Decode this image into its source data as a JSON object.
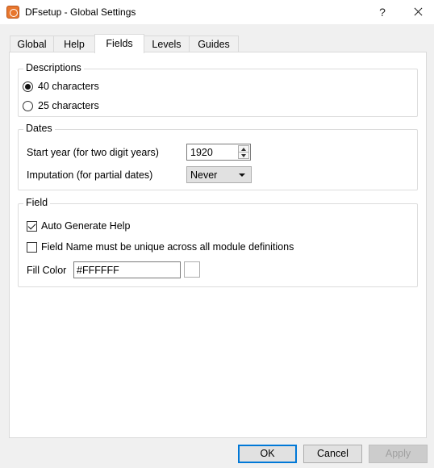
{
  "window": {
    "title": "DFsetup - Global Settings",
    "help_glyph": "?",
    "app_icon": "dfsetup-app-icon",
    "close_icon": "close-icon"
  },
  "tabs": [
    {
      "label": "Global",
      "active": false
    },
    {
      "label": "Help",
      "active": false
    },
    {
      "label": "Fields",
      "active": true
    },
    {
      "label": "Levels",
      "active": false
    },
    {
      "label": "Guides",
      "active": false
    }
  ],
  "descriptions": {
    "title": "Descriptions",
    "options": [
      {
        "label": "40 characters",
        "selected": true
      },
      {
        "label": "25 characters",
        "selected": false
      }
    ]
  },
  "dates": {
    "title": "Dates",
    "start_year_label": "Start year (for two digit years)",
    "start_year_value": "1920",
    "imputation_label": "Imputation (for partial dates)",
    "imputation_value": "Never"
  },
  "field": {
    "title": "Field",
    "auto_generate_help": {
      "label": "Auto Generate Help",
      "checked": true
    },
    "unique_name": {
      "label": "Field Name must be unique across all module definitions",
      "checked": false
    },
    "fill_color_label": "Fill Color",
    "fill_color_value": "#FFFFFF",
    "fill_color_swatch": "#ffffff"
  },
  "buttons": {
    "ok": "OK",
    "cancel": "Cancel",
    "apply": "Apply"
  }
}
